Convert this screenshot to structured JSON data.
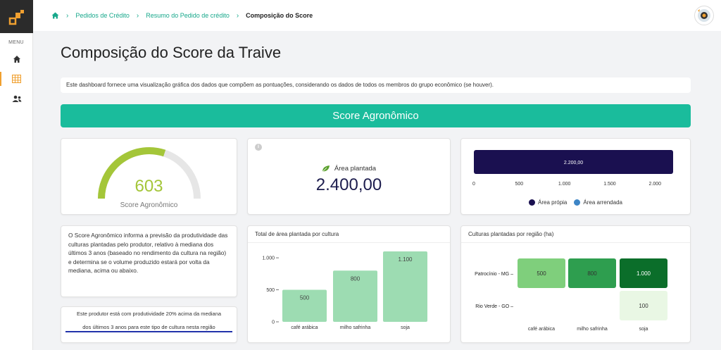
{
  "sidebar": {
    "menu_label": "MENU",
    "items": [
      {
        "icon": "home-icon"
      },
      {
        "icon": "grid-icon",
        "active": true
      },
      {
        "icon": "users-icon"
      }
    ]
  },
  "breadcrumb": {
    "items": [
      "Pedidos de Crédito",
      "Resumo do Pedido de crédito"
    ],
    "current": "Composição do Score"
  },
  "page": {
    "title": "Composição do Score da Traive",
    "info": "Este dashboard fornece uma visualização gráfica dos dados que compõem as pontuações, considerando os dados de todos os membros do grupo econômico (se houver).",
    "banner": "Score Agronômico"
  },
  "gauge": {
    "value": "603",
    "label": "Score Agronômico",
    "fraction": 0.603,
    "color": "#a4c639"
  },
  "area": {
    "info_icon": "i",
    "label": "Área plantada",
    "value": "2.400,00"
  },
  "description": {
    "text": "O Score Agronômico informa a previsão da produtividade das culturas plantadas pelo produtor, relativo à mediana dos últimos 3 anos (baseado no rendimento da cultura na região) e determina se o volume produzido estará por volta da mediana, acima ou abaixo.",
    "highlight_line1": "Este produtor está com produtividade 20% acima da mediana",
    "highlight_line2": "dos últimos 3 anos para este tipo de cultura nesta região"
  },
  "chart_data": [
    {
      "type": "bar",
      "orientation": "horizontal",
      "series": [
        {
          "name": "Área própia",
          "values": [
            2200
          ],
          "color": "#1a1050"
        },
        {
          "name": "Área arrendada",
          "values": [
            0
          ],
          "color": "#3d85c6"
        }
      ],
      "data_labels": [
        "2.200,00"
      ],
      "x_ticks": [
        "0",
        "500",
        "1.000",
        "1.500",
        "2.000"
      ],
      "xlim": [
        0,
        2200
      ],
      "legend": "bottom"
    },
    {
      "type": "bar",
      "title": "Total de área plantada por cultura",
      "categories": [
        "café arábica",
        "milho safrinha",
        "soja"
      ],
      "values": [
        500,
        800,
        1100
      ],
      "data_labels": [
        "500",
        "800",
        "1.100"
      ],
      "y_ticks": [
        "0",
        "500",
        "1.000"
      ],
      "ylim": [
        0,
        1100
      ],
      "color": "#9ddcb2"
    },
    {
      "type": "heatmap",
      "title": "Culturas plantadas por região (ha)",
      "rows": [
        "Patrocínio - MG",
        "Rio Verde - GO"
      ],
      "columns": [
        "café arábica",
        "milho safrinha",
        "soja"
      ],
      "values": [
        [
          500,
          800,
          1000
        ],
        [
          null,
          null,
          100
        ]
      ],
      "labels": [
        [
          "500",
          "800",
          "1.000"
        ],
        [
          "",
          "",
          "100"
        ]
      ]
    }
  ]
}
